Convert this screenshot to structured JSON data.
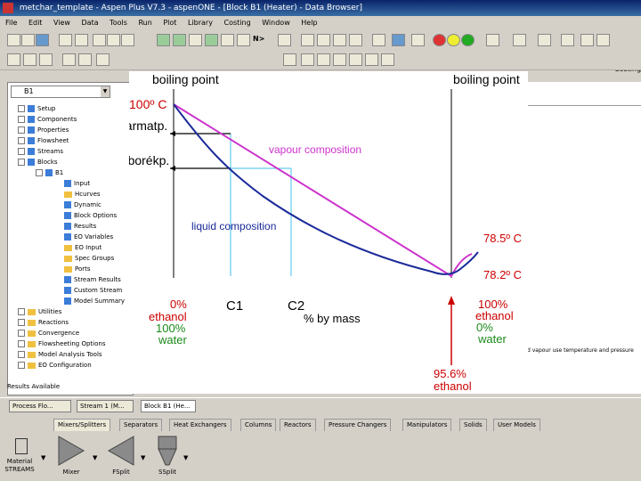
{
  "window": {
    "title": "metchar_template - Aspen Plus V7.3 - aspenONE - [Block B1 (Heater) - Data Browser]"
  },
  "menu": [
    "File",
    "Edit",
    "View",
    "Data",
    "Tools",
    "Run",
    "Plot",
    "Library",
    "Costing",
    "Window",
    "Help"
  ],
  "toolbar": {
    "nplus": "N>",
    "costing": "Costing"
  },
  "browser": {
    "block_selector": "B1",
    "tree": [
      {
        "label": "Setup",
        "level": 0,
        "icon": "check"
      },
      {
        "label": "Components",
        "level": 0,
        "icon": "check"
      },
      {
        "label": "Properties",
        "level": 0,
        "icon": "check"
      },
      {
        "label": "Flowsheet",
        "level": 0,
        "icon": "check"
      },
      {
        "label": "Streams",
        "level": 0,
        "icon": "check"
      },
      {
        "label": "Blocks",
        "level": 0,
        "icon": "check"
      },
      {
        "label": "B1",
        "level": 1,
        "icon": "check"
      },
      {
        "label": "Input",
        "level": 2,
        "icon": "check"
      },
      {
        "label": "Hcurves",
        "level": 2,
        "icon": "folder"
      },
      {
        "label": "Dynamic",
        "level": 2,
        "icon": "check"
      },
      {
        "label": "Block Options",
        "level": 2,
        "icon": "check"
      },
      {
        "label": "Results",
        "level": 2,
        "icon": "check"
      },
      {
        "label": "EO Variables",
        "level": 2,
        "icon": "check"
      },
      {
        "label": "EO Input",
        "level": 2,
        "icon": "folder"
      },
      {
        "label": "Spec Groups",
        "level": 2,
        "icon": "folder"
      },
      {
        "label": "Ports",
        "level": 2,
        "icon": "folder"
      },
      {
        "label": "Stream Results",
        "level": 2,
        "icon": "check"
      },
      {
        "label": "Custom Stream",
        "level": 2,
        "icon": "check"
      },
      {
        "label": "Model Summary",
        "level": 2,
        "icon": "check"
      },
      {
        "label": "Utilities",
        "level": 0,
        "icon": "folder"
      },
      {
        "label": "Reactions",
        "level": 0,
        "icon": "folder"
      },
      {
        "label": "Convergence",
        "level": 0,
        "icon": "folder"
      },
      {
        "label": "Flowsheeting Options",
        "level": 0,
        "icon": "folder"
      },
      {
        "label": "Model Analysis Tools",
        "level": 0,
        "icon": "folder"
      },
      {
        "label": "EO Configuration",
        "level": 0,
        "icon": "folder"
      }
    ],
    "status": "Results Available"
  },
  "right_note": "d vapour use temperature and pressure",
  "taskbar": [
    "Process Flo...",
    "Stream 1 (M...",
    "Block B1 (He..."
  ],
  "palette": {
    "tabs": [
      "Mixers/Splitters",
      "Separators",
      "Heat Exchangers",
      "Columns",
      "Reactors",
      "Pressure Changers",
      "Manipulators",
      "Solids",
      "User Models"
    ],
    "items": [
      {
        "label": "Material STREAMS"
      },
      {
        "label": "Mixer"
      },
      {
        "label": "FSplit"
      },
      {
        "label": "SSplit"
      }
    ]
  },
  "chart_data": {
    "type": "line",
    "top_left": "boiling point",
    "top_right": "boiling point",
    "annotations": {
      "temp_100": "100º C",
      "harmatp": "harmatp.",
      "buborekp": "buborékp.",
      "vapour": "vapour composition",
      "liquid": "liquid composition",
      "temp_785": "78.5º C",
      "temp_782": "78.2º C",
      "x0": "0%",
      "x0_line2": "ethanol",
      "x0_water": "100%",
      "x0_water2": "water",
      "c1": "C1",
      "c2": "C2",
      "xlabel": "% by mass",
      "x100": "100%",
      "x100_line2": "ethanol",
      "x100_water": "0%",
      "x100_water2": "water",
      "azeo": "95.6%",
      "azeo2": "ethanol"
    },
    "colors": {
      "vapour": "#cc33cc",
      "liquid": "#1a2a9a",
      "annot_red": "#cc0000",
      "annot_green": "#1a8a1a",
      "guide": "#66ccee"
    }
  }
}
